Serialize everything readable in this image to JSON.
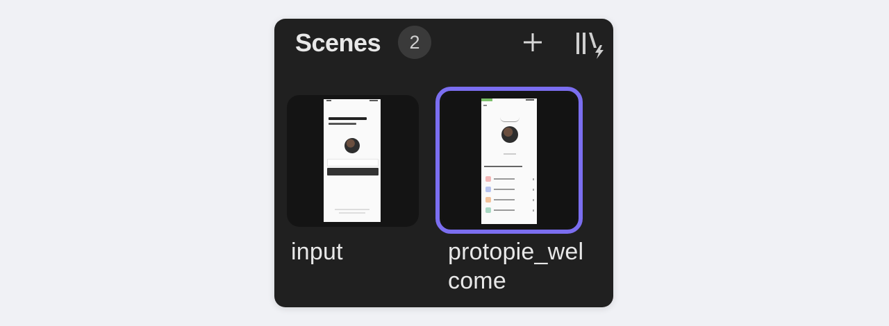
{
  "panel": {
    "title": "Scenes",
    "scene_count": "2",
    "add_icon": "plus-icon",
    "trigger_icon": "scene-trigger-icon",
    "accent_color": "#7b6ef0"
  },
  "scenes": [
    {
      "name": "input",
      "selected": false
    },
    {
      "name": "protopie_welcome",
      "selected": true
    }
  ]
}
